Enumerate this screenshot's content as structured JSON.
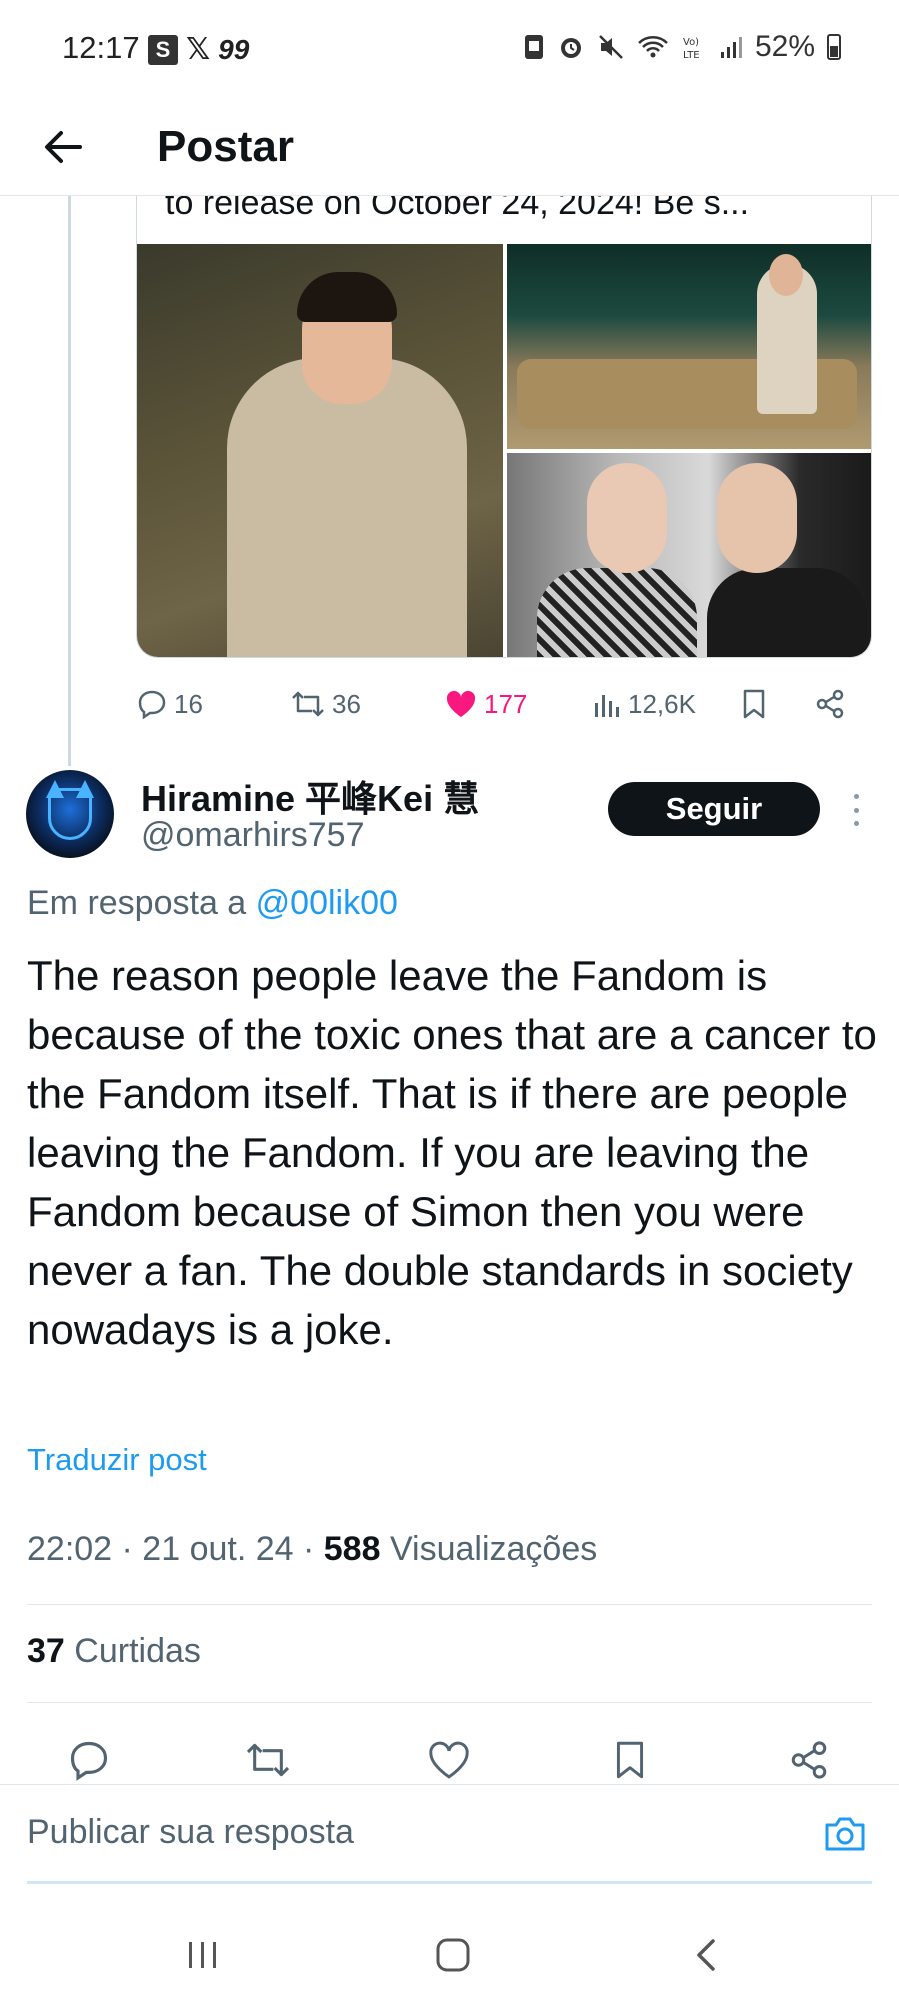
{
  "status_bar": {
    "time": "12:17",
    "app_s": "S",
    "app_x": "𝕏",
    "app_99": "99",
    "battery": "52%"
  },
  "header": {
    "title": "Postar"
  },
  "quoted_post": {
    "text_fragment": "to release on October 24, 2024! Be s...",
    "actions": {
      "replies": "16",
      "reposts": "36",
      "likes": "177",
      "views": "12,6K"
    }
  },
  "post": {
    "display_name": "Hiramine 平峰Kei 慧",
    "handle": "@omarhirs757",
    "follow_label": "Seguir",
    "reply_prefix": "Em resposta a",
    "reply_mention": "@00lik00",
    "body": "The reason people leave the Fandom is because of the toxic ones that are a cancer to the Fandom itself. That is if there are people leaving the Fandom. If you are leaving the Fandom because of Simon then you were never a fan. The double standards in society nowadays is a joke.",
    "translate_label": "Traduzir post",
    "timestamp": "22:02 · 21 out. 24 ·",
    "views_count": "588",
    "views_label": "Visualizações",
    "likes_count": "37",
    "likes_label": "Curtidas"
  },
  "compose": {
    "placeholder": "Publicar sua resposta"
  },
  "colors": {
    "accent": "#1d9bf0",
    "like": "#f91880",
    "text": "#0f1419",
    "muted": "#536471"
  }
}
